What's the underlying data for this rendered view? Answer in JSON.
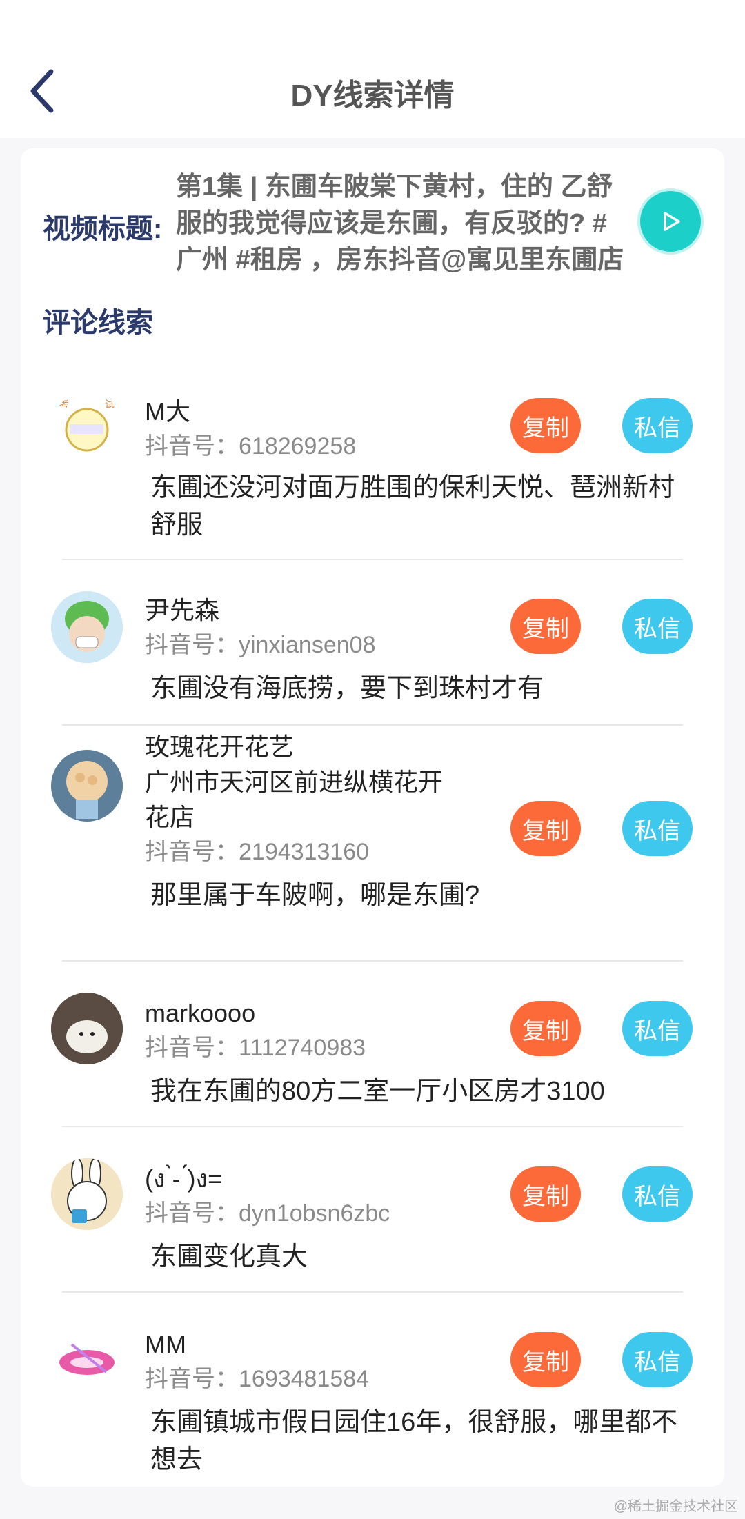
{
  "header": {
    "title": "DY线索详情"
  },
  "video": {
    "label": "视频标题:",
    "title_lines": [
      "第1集 | 东圃车陂棠下黄村，住的 乙舒",
      "服的我觉得应该是东圃，有反驳的? #",
      "广州 #租房 ，房东抖音@寓见里东圃店"
    ]
  },
  "section": {
    "title": "评论线索"
  },
  "actions": {
    "copy_label": "复制",
    "dm_label": "私信"
  },
  "comments": [
    {
      "name": "M大",
      "dy_prefix": "抖音号：",
      "dy_id": "618269258",
      "text_lines": [
        "东圃还没河对面万胜围的保利天悦、琶洲新村",
        "舒服"
      ]
    },
    {
      "name": "尹先森",
      "dy_prefix": "抖音号：",
      "dy_id": "yinxiansen08",
      "text_lines": [
        "东圃没有海底捞，要下到珠村才有"
      ]
    },
    {
      "name_lines": [
        "玫瑰花开花艺",
        "广州市天河区前进纵横花开",
        "花店"
      ],
      "dy_prefix": "抖音号：",
      "dy_id": "2194313160",
      "text_lines": [
        "那里属于车陂啊，哪是东圃?"
      ]
    },
    {
      "name": "markoooo",
      "dy_prefix": "抖音号：",
      "dy_id": "1112740983",
      "text_lines": [
        "我在东圃的80方二室一厅小区房才3100"
      ]
    },
    {
      "name": "(ง ̀-  ́)ง=",
      "dy_prefix": "抖音号：",
      "dy_id": "dyn1obsn6zbc",
      "text_lines": [
        "东圃变化真大"
      ]
    },
    {
      "name": "MM",
      "dy_prefix": "抖音号：",
      "dy_id": "1693481584",
      "text_lines": [
        "东圃镇城市假日园住16年，很舒服，哪里都不",
        "想去"
      ]
    }
  ],
  "watermark": "@稀土掘金技术社区",
  "colors": {
    "copy": "#fc6a3a",
    "dm": "#3fc8ee",
    "play": "#1ccfc9",
    "heading": "#2b3a6b"
  }
}
